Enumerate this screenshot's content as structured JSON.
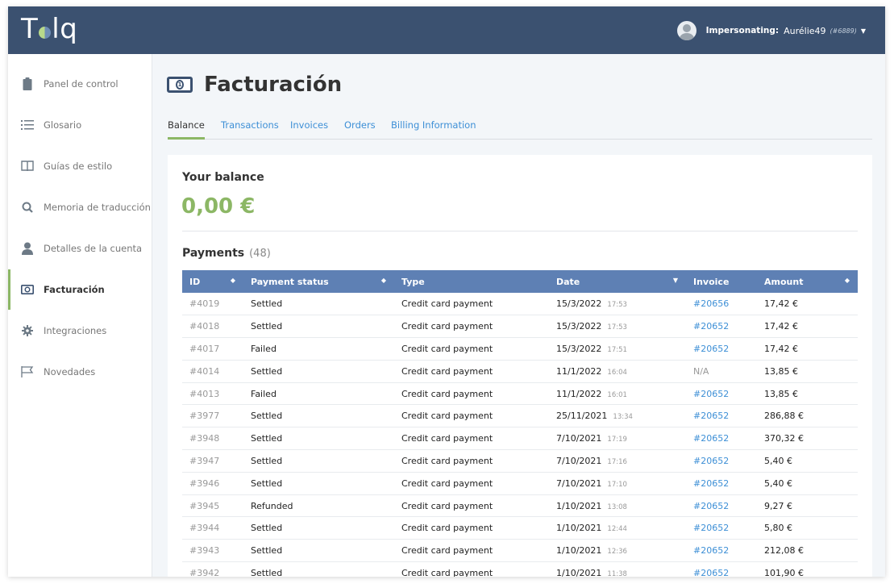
{
  "header": {
    "logo": "Tolq",
    "impersonating_label": "Impersonating:",
    "user_name": "Aurélie49",
    "user_id": "(#6889)"
  },
  "sidebar": {
    "items": [
      {
        "label": "Panel de control",
        "icon": "clipboard-icon"
      },
      {
        "label": "Glosario",
        "icon": "list-icon"
      },
      {
        "label": "Guías de estilo",
        "icon": "book-icon"
      },
      {
        "label": "Memoria de traducción",
        "icon": "search-icon"
      },
      {
        "label": "Detalles de la cuenta",
        "icon": "user-icon"
      },
      {
        "label": "Facturación",
        "icon": "money-icon",
        "active": true
      },
      {
        "label": "Integraciones",
        "icon": "gear-icon"
      },
      {
        "label": "Novedades",
        "icon": "flag-icon"
      }
    ]
  },
  "page": {
    "title": "Facturación",
    "tabs": [
      "Balance",
      "Transactions",
      "Invoices",
      "Orders",
      "Billing Information"
    ],
    "active_tab": "Balance"
  },
  "balance": {
    "title": "Your balance",
    "amount": "0,00 €"
  },
  "payments": {
    "title": "Payments",
    "count": "(48)",
    "columns": [
      "ID",
      "Payment status",
      "Type",
      "Date",
      "Invoice",
      "Amount"
    ],
    "rows": [
      {
        "id": "#4019",
        "status": "Settled",
        "type": "Credit card payment",
        "date": "15/3/2022",
        "time": "17:53",
        "invoice": "#20656",
        "amount": "17,42 €"
      },
      {
        "id": "#4018",
        "status": "Settled",
        "type": "Credit card payment",
        "date": "15/3/2022",
        "time": "17:53",
        "invoice": "#20652",
        "amount": "17,42 €"
      },
      {
        "id": "#4017",
        "status": "Failed",
        "type": "Credit card payment",
        "date": "15/3/2022",
        "time": "17:51",
        "invoice": "#20652",
        "amount": "17,42 €"
      },
      {
        "id": "#4014",
        "status": "Settled",
        "type": "Credit card payment",
        "date": "11/1/2022",
        "time": "16:04",
        "invoice": "N/A",
        "amount": "13,85 €"
      },
      {
        "id": "#4013",
        "status": "Failed",
        "type": "Credit card payment",
        "date": "11/1/2022",
        "time": "16:01",
        "invoice": "#20652",
        "amount": "13,85 €"
      },
      {
        "id": "#3977",
        "status": "Settled",
        "type": "Credit card payment",
        "date": "25/11/2021",
        "time": "13:34",
        "invoice": "#20652",
        "amount": "286,88 €"
      },
      {
        "id": "#3948",
        "status": "Settled",
        "type": "Credit card payment",
        "date": "7/10/2021",
        "time": "17:19",
        "invoice": "#20652",
        "amount": "370,32 €"
      },
      {
        "id": "#3947",
        "status": "Settled",
        "type": "Credit card payment",
        "date": "7/10/2021",
        "time": "17:16",
        "invoice": "#20652",
        "amount": "5,40 €"
      },
      {
        "id": "#3946",
        "status": "Settled",
        "type": "Credit card payment",
        "date": "7/10/2021",
        "time": "17:10",
        "invoice": "#20652",
        "amount": "5,40 €"
      },
      {
        "id": "#3945",
        "status": "Refunded",
        "type": "Credit card payment",
        "date": "1/10/2021",
        "time": "13:08",
        "invoice": "#20652",
        "amount": "9,27 €"
      },
      {
        "id": "#3944",
        "status": "Settled",
        "type": "Credit card payment",
        "date": "1/10/2021",
        "time": "12:44",
        "invoice": "#20652",
        "amount": "5,80 €"
      },
      {
        "id": "#3943",
        "status": "Settled",
        "type": "Credit card payment",
        "date": "1/10/2021",
        "time": "12:36",
        "invoice": "#20652",
        "amount": "212,08 €"
      },
      {
        "id": "#3942",
        "status": "Settled",
        "type": "Credit card payment",
        "date": "1/10/2021",
        "time": "11:38",
        "invoice": "#20652",
        "amount": "101,90 €"
      }
    ]
  },
  "colors": {
    "topbar": "#3b5170",
    "accent_green": "#8cb765",
    "link_blue": "#3d8fd6",
    "table_header": "#5e80b4"
  }
}
